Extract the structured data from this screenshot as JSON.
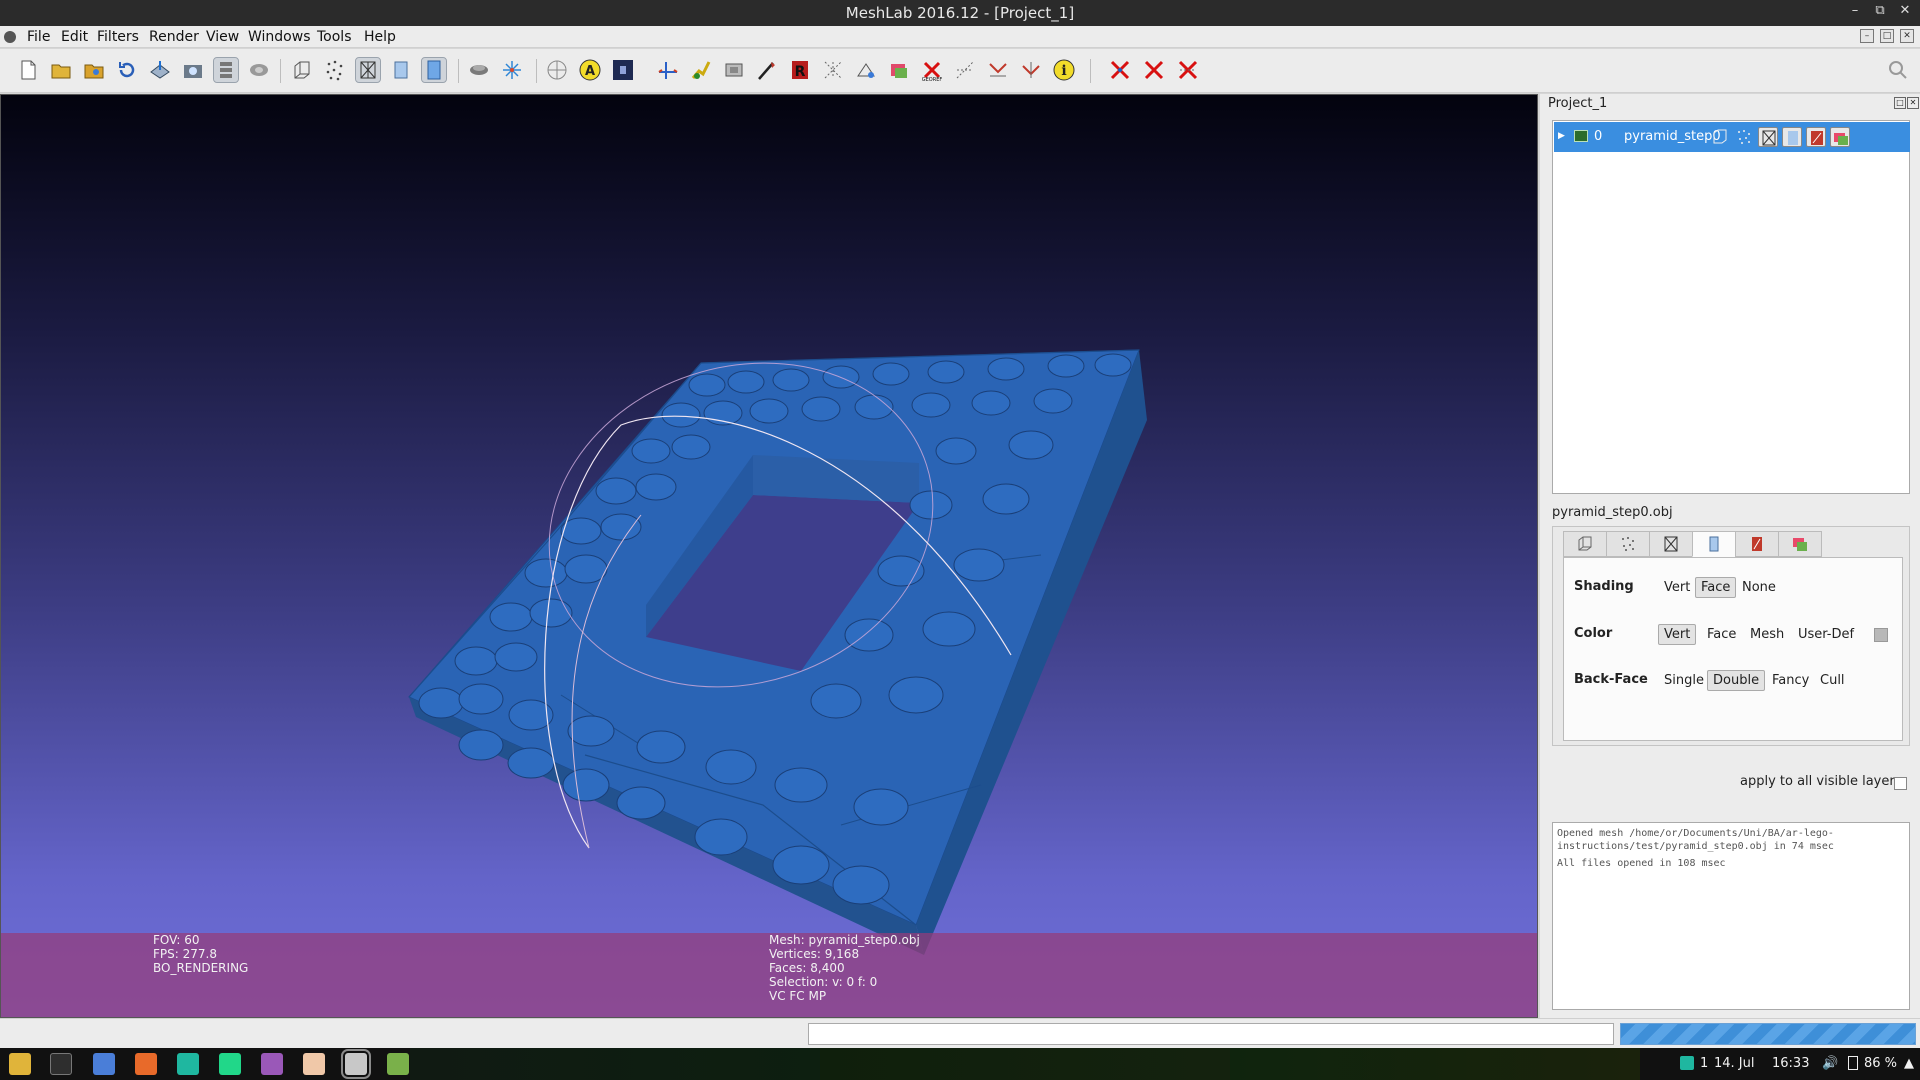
{
  "window": {
    "title": "MeshLab 2016.12 - [Project_1]",
    "controls": [
      "–",
      "⧉",
      "✕"
    ]
  },
  "menu": {
    "items": [
      "File",
      "Edit",
      "Filters",
      "Render",
      "View",
      "Windows",
      "Tools",
      "Help"
    ]
  },
  "toolbar": {
    "icons": [
      "new-project-icon",
      "open-project-icon",
      "import-mesh-icon",
      "reload-icon",
      "export-icon",
      "snapshot-icon",
      "layers-icon",
      "pan-icon",
      "bbox-icon",
      "points-icon",
      "wireframe-icon",
      "flat-icon",
      "smooth-icon",
      "light-icon",
      "trackball-icon",
      "axis-icon",
      "annotation-icon",
      "raster-icon",
      "measure-icon",
      "pick-icon",
      "paint-icon",
      "select-faces-icon",
      "select-vertices-icon",
      "georef-icon",
      "color-icon",
      "info-icon",
      "delete-faces-icon",
      "delete-vertices-icon",
      "delete-both-icon"
    ]
  },
  "viewport": {
    "info_left": [
      "FOV: 60",
      "FPS:   277.8",
      "BO_RENDERING"
    ],
    "info_right": [
      "Mesh: pyramid_step0.obj",
      "Vertices: 9,168",
      "Faces: 8,400",
      "Selection: v: 0 f: 0",
      "VC FC MP"
    ]
  },
  "panel": {
    "title": "Project_1",
    "layer": {
      "index": "0",
      "name": "pyramid_step0"
    },
    "mesh_file": "pyramid_step0.obj",
    "shading": {
      "label": "Shading",
      "options": [
        "Vert",
        "Face",
        "None"
      ],
      "selected": "Face"
    },
    "color": {
      "label": "Color",
      "options": [
        "Vert",
        "Face",
        "Mesh",
        "User-Def"
      ],
      "selected": "Vert"
    },
    "backface": {
      "label": "Back-Face",
      "options": [
        "Single",
        "Double",
        "Fancy",
        "Cull"
      ],
      "selected": "Double"
    },
    "apply_all": "apply to all visible layers",
    "log": [
      "Opened mesh /home/or/Documents/Uni/BA/ar-lego-",
      "instructions/test/pyramid_step0.obj in 74 msec",
      "All files opened in 108 msec"
    ]
  },
  "taskbar": {
    "apps": [
      "files-icon",
      "terminal-icon",
      "chromium-icon",
      "tasks-icon",
      "clion-icon",
      "pycharm-icon",
      "editor-icon",
      "notes-icon",
      "eclipse-icon",
      "meshlab-icon"
    ],
    "tray": {
      "workspace": "1",
      "date": "14. Jul",
      "time": "16:33",
      "battery": "86 %"
    }
  },
  "colors": {
    "accent": "#3a8ee0",
    "brick": "#2a66b8",
    "info_band": "#963c78"
  }
}
